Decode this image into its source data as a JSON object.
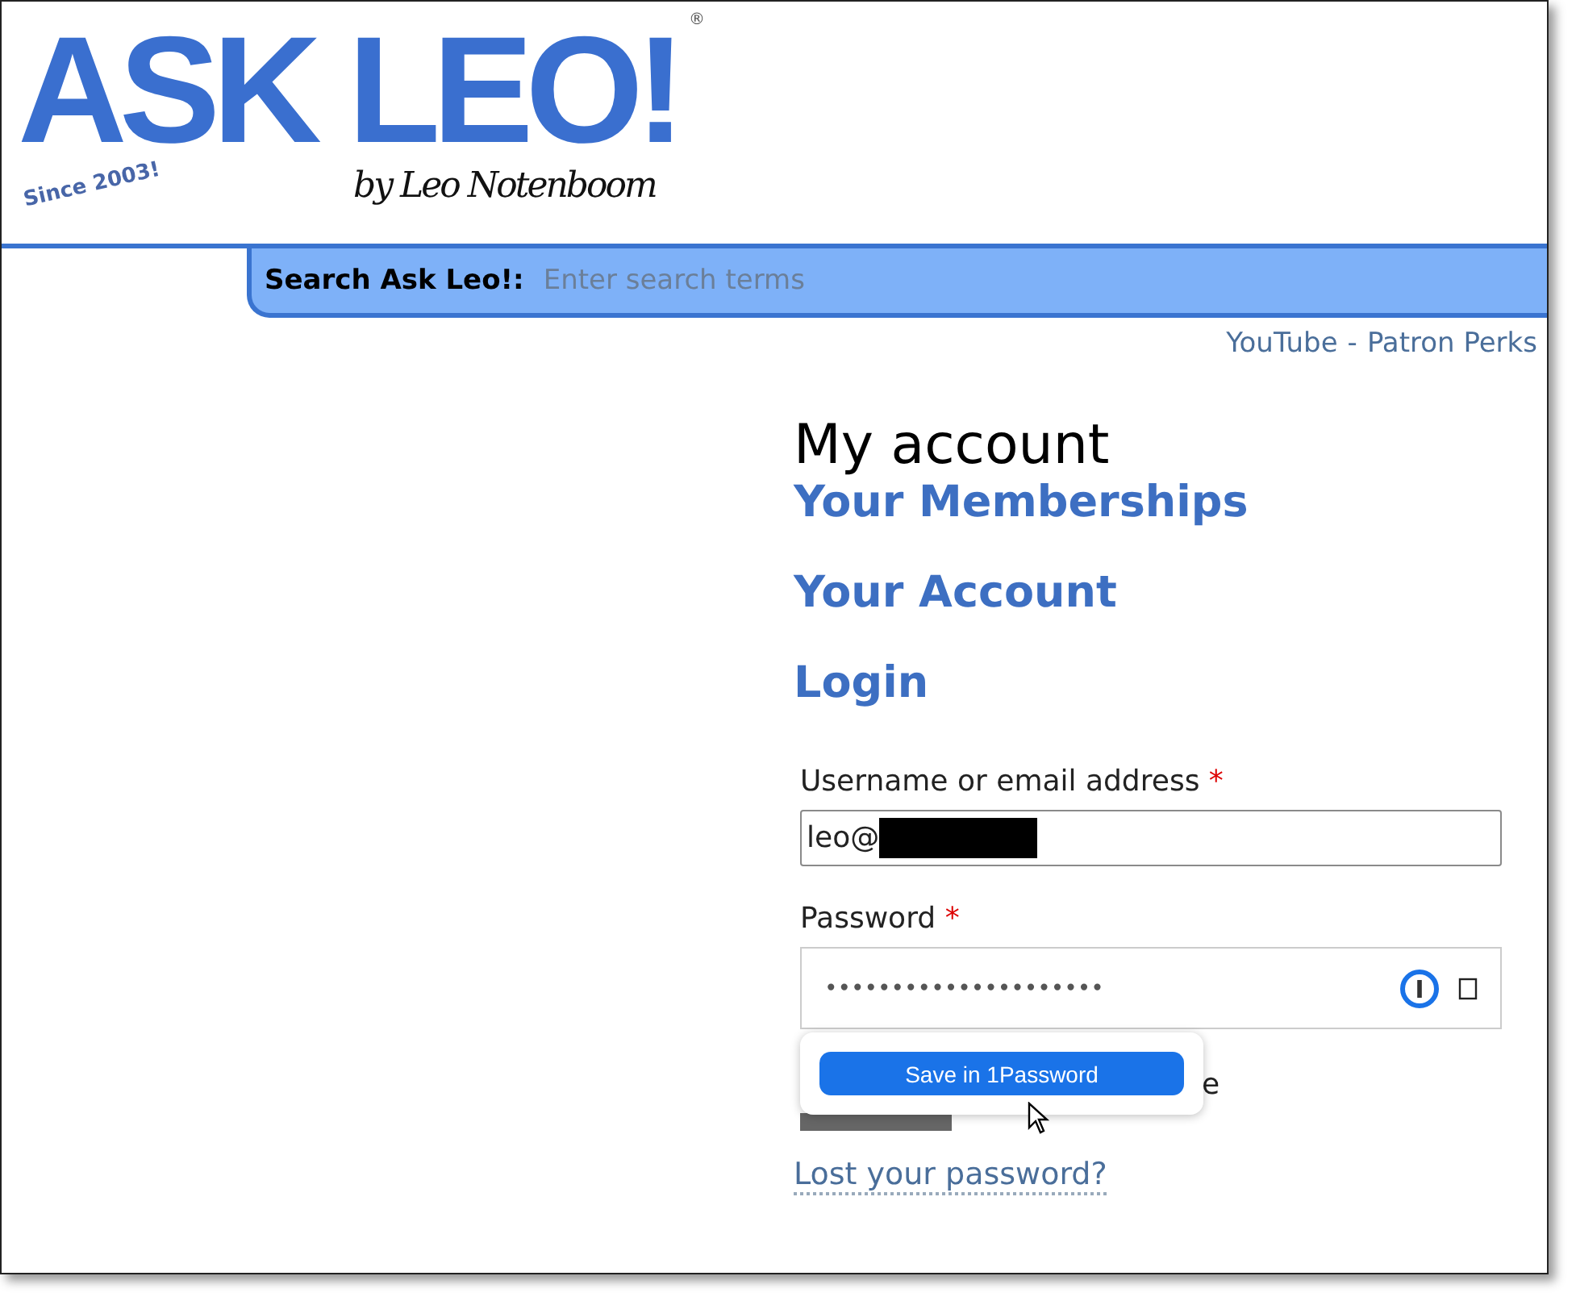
{
  "logo": {
    "title": "ASK LEO!",
    "registered": "®",
    "tagline": "by Leo Notenboom",
    "since": "Since 2003!"
  },
  "search": {
    "label": "Search Ask Leo!:",
    "placeholder": "Enter search terms"
  },
  "top_links": [
    {
      "label": "YouTube"
    },
    {
      "label": "Patron Perks"
    }
  ],
  "top_links_separator": "-",
  "heading": "My account",
  "account_links": [
    {
      "label": "Your Memberships"
    },
    {
      "label": "Your Account"
    },
    {
      "label": "Login"
    }
  ],
  "form": {
    "username_label": "Username or email address",
    "required_mark": "*",
    "username_value": "leo@",
    "username_redacted": true,
    "password_label": "Password",
    "password_value": "•••••••••••••••••••••",
    "remember_visible_text": "e",
    "lost_password": "Lost your password?"
  },
  "popup": {
    "button": "Save in 1Password"
  }
}
